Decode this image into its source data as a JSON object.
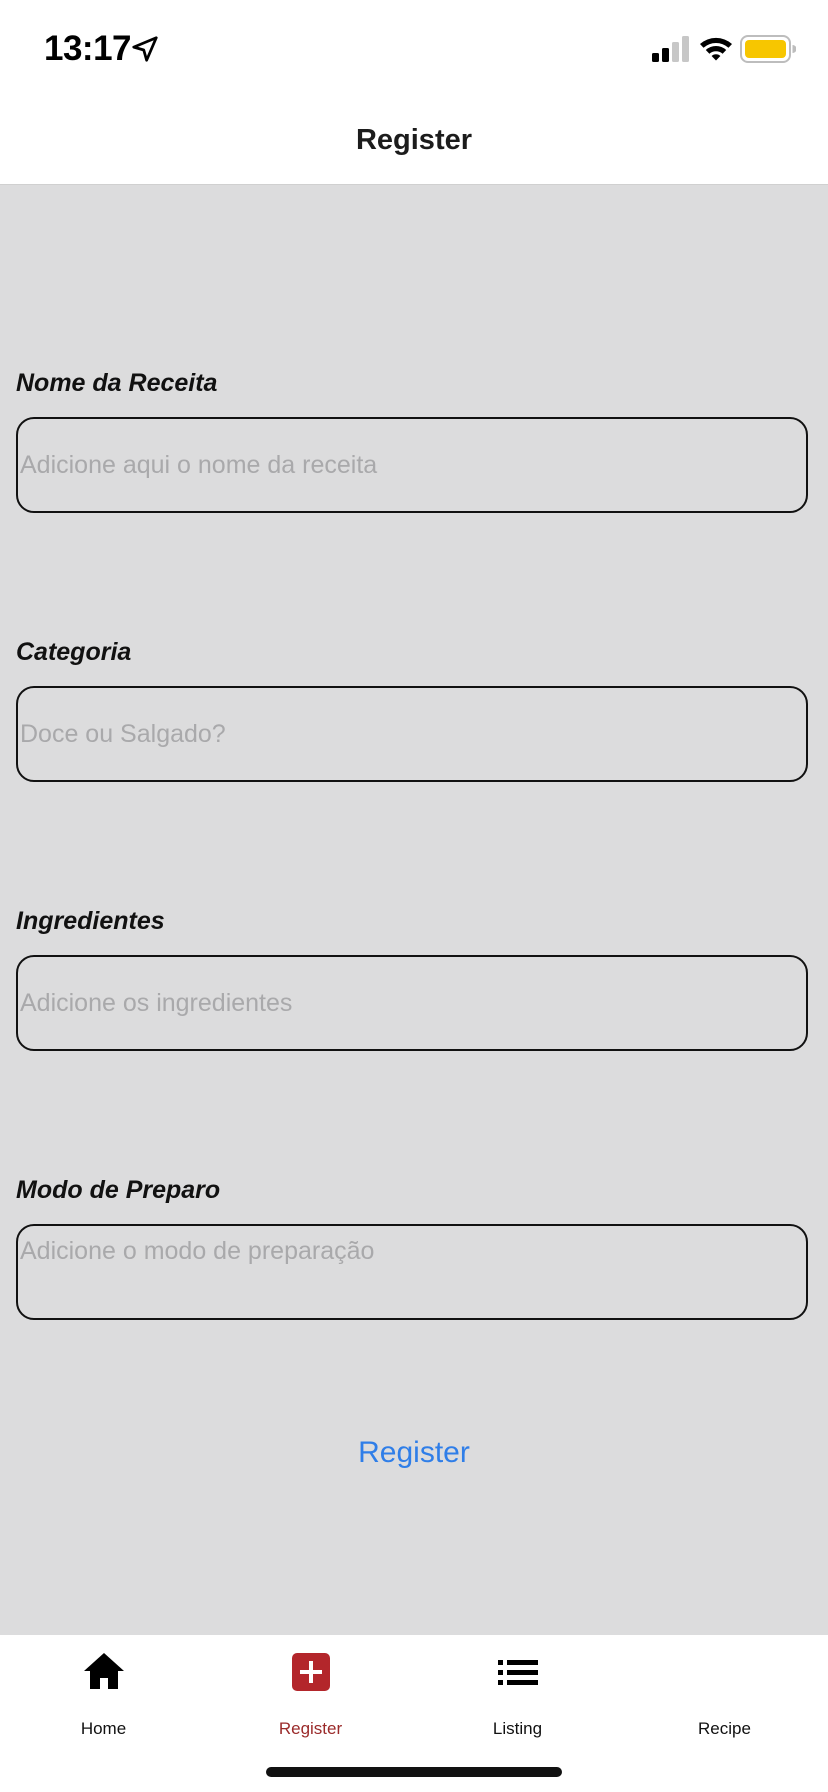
{
  "status_bar": {
    "time": "13:17",
    "icons": [
      "location-arrow-icon",
      "cellular-signal-icon",
      "wifi-icon",
      "battery-icon"
    ],
    "battery_color": "#f7c600"
  },
  "header": {
    "title": "Register"
  },
  "form": {
    "fields": [
      {
        "label": "Nome da Receita",
        "placeholder": "Adicione aqui o nome da receita",
        "value": ""
      },
      {
        "label": "Categoria",
        "placeholder": "Doce ou Salgado?",
        "value": ""
      },
      {
        "label": "Ingredientes",
        "placeholder": "Adicione os ingredientes",
        "value": ""
      },
      {
        "label": "Modo de Preparo",
        "placeholder": "Adicione o modo de preparação",
        "value": ""
      }
    ],
    "submit_label": "Register"
  },
  "tab_bar": {
    "active_index": 1,
    "items": [
      {
        "label": "Home",
        "icon": "home-icon"
      },
      {
        "label": "Register",
        "icon": "add-square-icon"
      },
      {
        "label": "Listing",
        "icon": "list-icon"
      },
      {
        "label": "Recipe",
        "icon": ""
      }
    ]
  },
  "colors": {
    "background": "#dcdcdd",
    "accent": "#2f7ee8",
    "active_tab": "#9a2a2a",
    "register_icon_bg": "#b3262b"
  }
}
